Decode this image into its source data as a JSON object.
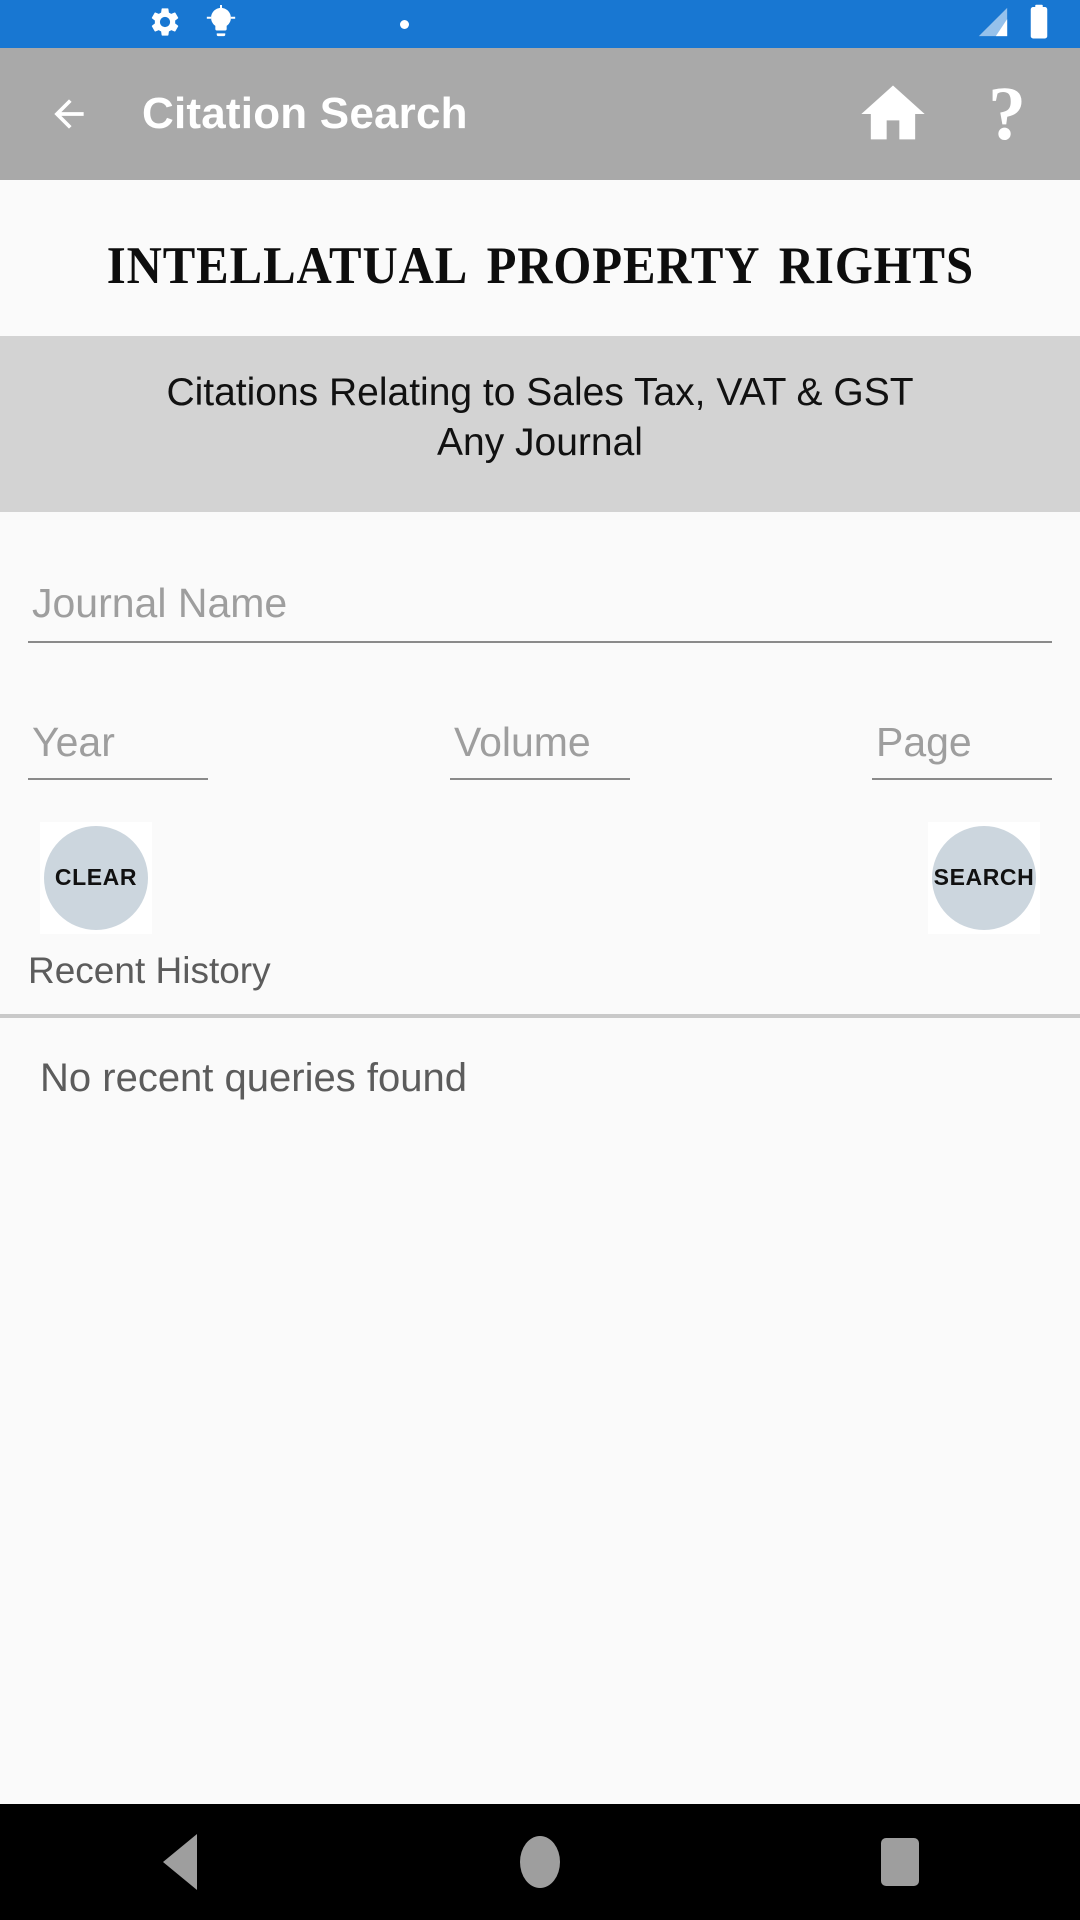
{
  "status_bar": {
    "background_color": "#1877d2",
    "icons": [
      "gear-icon",
      "brightness-icon",
      "dot-indicator",
      "signal-icon",
      "battery-icon"
    ]
  },
  "app_bar": {
    "title": "Citation Search",
    "background_color": "#a9a9a9",
    "back_label": "Back",
    "home_label": "Home",
    "help_label": "?"
  },
  "masthead": {
    "title": "Intellatual Property Rights"
  },
  "subtitle": {
    "line1": "Citations Relating to Sales Tax, VAT & GST",
    "line2": "Any Journal",
    "background_color": "#d3d3d3"
  },
  "form": {
    "journal": {
      "placeholder": "Journal Name",
      "value": ""
    },
    "year": {
      "placeholder": "Year",
      "value": ""
    },
    "volume": {
      "placeholder": "Volume",
      "value": ""
    },
    "page": {
      "placeholder": "Page",
      "value": ""
    }
  },
  "buttons": {
    "clear_label": "CLEAR",
    "search_label": "SEARCH",
    "circle_color": "#ccd6de"
  },
  "history": {
    "heading": "Recent History",
    "empty_message": "No recent queries found"
  },
  "nav_bar": {
    "back_label": "Back",
    "home_label": "Home",
    "recents_label": "Recent apps"
  }
}
